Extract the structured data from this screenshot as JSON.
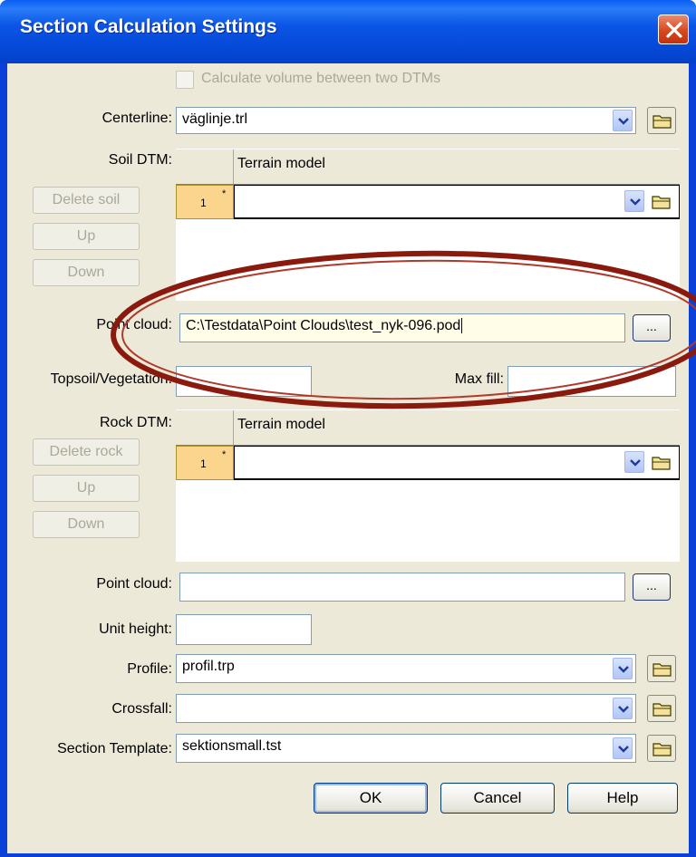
{
  "window": {
    "title": "Section Calculation Settings"
  },
  "colors": {
    "titlebar": "#0a55e6",
    "dialog_bg": "#ece9d8",
    "close": "#d8481f",
    "grid_row_header": "#fbd58d",
    "annotation_ellipse": "#8b1a0e"
  },
  "calc_volume": {
    "label": "Calculate volume between two DTMs",
    "checked": false,
    "enabled": false
  },
  "centerline": {
    "label": "Centerline:",
    "value": "väglinje.trl"
  },
  "soil_dtm": {
    "label": "Soil DTM:",
    "column_header": "Terrain model",
    "rows": [
      {
        "number": "1",
        "marker": "*",
        "value": ""
      }
    ],
    "buttons": {
      "delete": "Delete soil",
      "up": "Up",
      "down": "Down"
    }
  },
  "soil_point_cloud": {
    "label": "Point cloud:",
    "value": "C:\\Testdata\\Point Clouds\\test_nyk-096.pod",
    "browse": "..."
  },
  "topsoil": {
    "label": "Topsoil/Vegetation:",
    "value": ""
  },
  "max_fill": {
    "label": "Max fill:",
    "value": ""
  },
  "rock_dtm": {
    "label": "Rock DTM:",
    "column_header": "Terrain model",
    "rows": [
      {
        "number": "1",
        "marker": "*",
        "value": ""
      }
    ],
    "buttons": {
      "delete": "Delete rock",
      "up": "Up",
      "down": "Down"
    }
  },
  "rock_point_cloud": {
    "label": "Point cloud:",
    "value": "",
    "browse": "..."
  },
  "unit_height": {
    "label": "Unit height:",
    "value": ""
  },
  "profile": {
    "label": "Profile:",
    "value": "profil.trp"
  },
  "crossfall": {
    "label": "Crossfall:",
    "value": ""
  },
  "section_template": {
    "label": "Section Template:",
    "value": "sektionsmall.tst"
  },
  "actions": {
    "ok": "OK",
    "cancel": "Cancel",
    "help": "Help"
  }
}
